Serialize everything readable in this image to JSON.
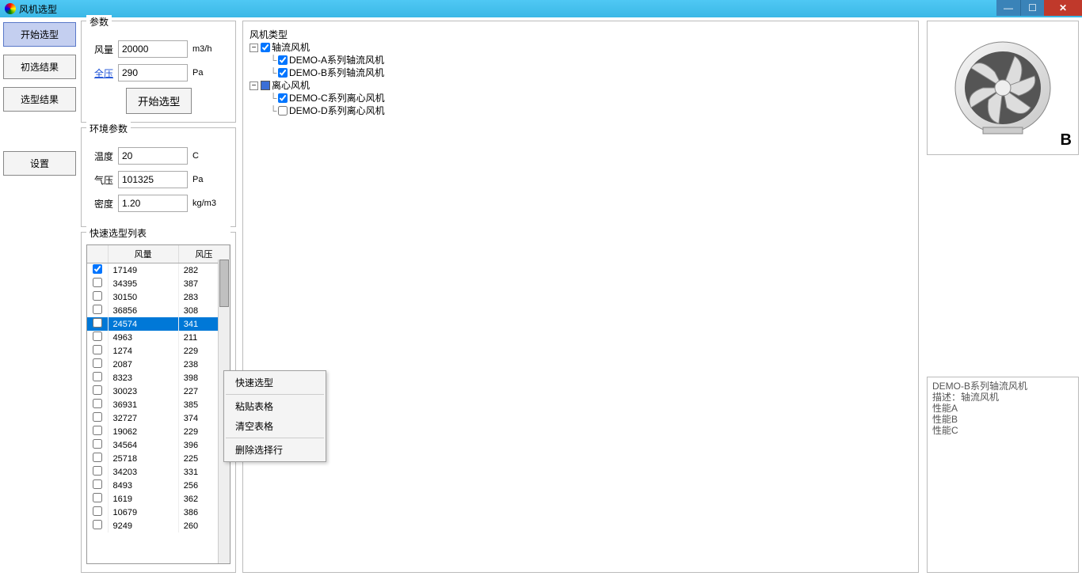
{
  "window": {
    "title": "风机选型"
  },
  "nav": {
    "start": "开始选型",
    "prelim": "初选结果",
    "result": "选型结果",
    "settings": "设置"
  },
  "params": {
    "group_label": "参数",
    "flow_label": "风量",
    "flow_value": "20000",
    "flow_unit": "m3/h",
    "pressure_label": "全压",
    "pressure_value": "290",
    "pressure_unit": "Pa",
    "start_btn": "开始选型"
  },
  "env": {
    "group_label": "环境参数",
    "temp_label": "温度",
    "temp_value": "20",
    "temp_unit": "C",
    "press_label": "气压",
    "press_value": "101325",
    "press_unit": "Pa",
    "density_label": "密度",
    "density_value": "1.20",
    "density_unit": "kg/m3"
  },
  "tree": {
    "group_label": "风机类型",
    "root1": "轴流风机",
    "r1c1": "DEMO-A系列轴流风机",
    "r1c2": "DEMO-B系列轴流风机",
    "root2": "离心风机",
    "r2c1": "DEMO-C系列离心风机",
    "r2c2": "DEMO-D系列离心风机"
  },
  "quicklist": {
    "group_label": "快速选型列表",
    "col1": "风量",
    "col2": "风压",
    "rows": [
      {
        "checked": true,
        "flow": "17149",
        "press": "282",
        "selected": false
      },
      {
        "checked": false,
        "flow": "34395",
        "press": "387",
        "selected": false
      },
      {
        "checked": false,
        "flow": "30150",
        "press": "283",
        "selected": false
      },
      {
        "checked": false,
        "flow": "36856",
        "press": "308",
        "selected": false
      },
      {
        "checked": false,
        "flow": "24574",
        "press": "341",
        "selected": true
      },
      {
        "checked": false,
        "flow": "4963",
        "press": "211",
        "selected": false
      },
      {
        "checked": false,
        "flow": "1274",
        "press": "229",
        "selected": false
      },
      {
        "checked": false,
        "flow": "2087",
        "press": "238",
        "selected": false
      },
      {
        "checked": false,
        "flow": "8323",
        "press": "398",
        "selected": false
      },
      {
        "checked": false,
        "flow": "30023",
        "press": "227",
        "selected": false
      },
      {
        "checked": false,
        "flow": "36931",
        "press": "385",
        "selected": false
      },
      {
        "checked": false,
        "flow": "32727",
        "press": "374",
        "selected": false
      },
      {
        "checked": false,
        "flow": "19062",
        "press": "229",
        "selected": false
      },
      {
        "checked": false,
        "flow": "34564",
        "press": "396",
        "selected": false
      },
      {
        "checked": false,
        "flow": "25718",
        "press": "225",
        "selected": false
      },
      {
        "checked": false,
        "flow": "34203",
        "press": "331",
        "selected": false
      },
      {
        "checked": false,
        "flow": "8493",
        "press": "256",
        "selected": false
      },
      {
        "checked": false,
        "flow": "1619",
        "press": "362",
        "selected": false
      },
      {
        "checked": false,
        "flow": "10679",
        "press": "386",
        "selected": false
      },
      {
        "checked": false,
        "flow": "9249",
        "press": "260",
        "selected": false
      }
    ]
  },
  "context_menu": {
    "quick_select": "快速选型",
    "paste_table": "粘贴表格",
    "clear_table": "清空表格",
    "delete_row": "删除选择行"
  },
  "detail": {
    "line1": "DEMO-B系列轴流风机",
    "line2": "描述：轴流风机",
    "line3": "性能A",
    "line4": "性能B",
    "line5": "性能C",
    "img_label": "B"
  }
}
